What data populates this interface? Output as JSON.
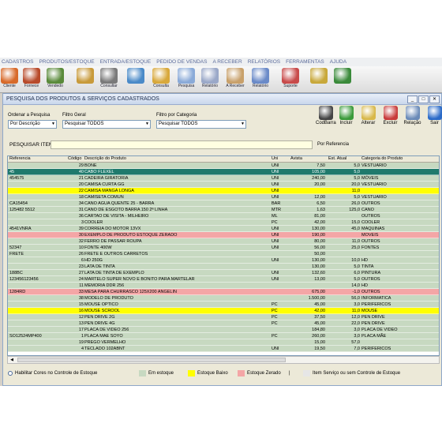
{
  "menu": [
    "CADASTROS",
    "PRODUTOS/ESTOQUE",
    "ENTRADA/ESTOQUE",
    "PEDIDO DE VENDAS",
    "A RECEBER",
    "RELATÓRIOS",
    "FERRAMENTAS",
    "AJUDA"
  ],
  "toolbar": [
    {
      "label": "Cliente",
      "color": "#d86a2a",
      "icon": "client-icon"
    },
    {
      "label": "Fornece",
      "color": "#b84a2a",
      "icon": "supplier-icon"
    },
    {
      "label": "Vendedo",
      "color": "#5a8a3a",
      "icon": "seller-icon"
    },
    {
      "label": "",
      "color": "#c89a3a",
      "icon": "boxes-icon"
    },
    {
      "label": "Consultar",
      "color": "#7a7a7a",
      "icon": "barcode-icon"
    },
    {
      "label": "",
      "color": "#4a8ac8",
      "icon": "monitor-icon"
    },
    {
      "label": "Consulta",
      "color": "#d8a83a",
      "icon": "folder-icon"
    },
    {
      "label": "Pesquisa",
      "color": "#8aaad8",
      "icon": "search-doc-icon"
    },
    {
      "label": "Relatório",
      "color": "#9aa8c8",
      "icon": "report-icon"
    },
    {
      "label": "A Receber",
      "color": "#c8a06a",
      "icon": "receivable-icon"
    },
    {
      "label": "Relatório",
      "color": "#6a8ac8",
      "icon": "report2-icon"
    },
    {
      "label": "Suporte",
      "color": "#c84a4a",
      "icon": "support-icon"
    },
    {
      "label": "",
      "color": "#c8a83a",
      "icon": "coins-icon"
    },
    {
      "label": "",
      "color": "#3a8a3a",
      "icon": "excel-icon"
    }
  ],
  "window": {
    "title": "PESQUISA DOS PRODUTOS & SERVIÇOS CADASTRADOS"
  },
  "filters": {
    "order_label": "Ordenar a Pesquisa",
    "order_value": "Por Descrição",
    "general_label": "Filtro Geral",
    "general_value": "Pesquisar TODOS",
    "category_label": "Filtro por Categoria",
    "category_value": "Pesquisar TODOS"
  },
  "actions": [
    {
      "label": "CodBarra",
      "color": "#444444",
      "icon": "barcode-icon"
    },
    {
      "label": "Incluir",
      "color": "#3a9a3a",
      "icon": "add-icon"
    },
    {
      "label": "Alterar",
      "color": "#d8b84a",
      "icon": "edit-icon"
    },
    {
      "label": "Excluir",
      "color": "#c83a3a",
      "icon": "delete-icon"
    },
    {
      "label": "Relação",
      "color": "#6a8ab8",
      "icon": "list-icon"
    },
    {
      "label": "Sair",
      "color": "#2a6ac8",
      "icon": "exit-icon"
    }
  ],
  "search": {
    "label": "PESQUISAR ITEM",
    "value": "",
    "ref_label": "Por Referencia"
  },
  "columns": [
    "Referencia",
    "Código",
    "Descrição do Produto",
    "Uni",
    "Avista",
    "Est. Atual",
    "Categoria do Produto"
  ],
  "rows": [
    {
      "ref": "",
      "cod": "29",
      "desc": "BONE",
      "uni": "UNI",
      "avista": "7,50",
      "est": "5,0",
      "cat": "VESTUARIO",
      "st": "ok"
    },
    {
      "ref": "45",
      "cod": "40",
      "desc": "CABO FLEXEL",
      "uni": "UNI",
      "avista": "105,00",
      "est": "5,0",
      "cat": "",
      "st": "sel"
    },
    {
      "ref": "454575",
      "cod": "21",
      "desc": "CADEIRA GIRATORIA",
      "uni": "UNI",
      "avista": "240,00",
      "est": "5,0",
      "cat": "MÓVEIS",
      "st": "ok"
    },
    {
      "ref": "",
      "cod": "20",
      "desc": "CAMISA CURTA GG",
      "uni": "UNI",
      "avista": "20,00",
      "est": "20,0",
      "cat": "VESTUARIO",
      "st": "ok"
    },
    {
      "ref": "",
      "cod": "22",
      "desc": "CAMISA MANGA LONGA",
      "uni": "UNI",
      "avista": "",
      "est": "11,0",
      "cat": "",
      "st": "low"
    },
    {
      "ref": "",
      "cod": "18",
      "desc": "CAMISETA COMUN",
      "uni": "UNI",
      "avista": "12,00",
      "est": "5,0",
      "cat": "VESTUARIO",
      "st": "ok"
    },
    {
      "ref": "CA15454",
      "cod": "34",
      "desc": "CANO AGUA QUENTE 25 - BARRA",
      "uni": "BAR",
      "avista": "6,50",
      "est": "26,0",
      "cat": "OUTROS",
      "st": "ok"
    },
    {
      "ref": "125482 5512",
      "cod": "31",
      "desc": "CANO DE ESGOTO BARRA 150 2ª LINHA",
      "uni": "MTR",
      "avista": "1,63",
      "est": "125,0",
      "cat": "CANO",
      "st": "ok"
    },
    {
      "ref": "",
      "cod": "36",
      "desc": "CARTAO DE VISITA - MILHEIRO",
      "uni": "ML",
      "avista": "81,00",
      "est": "",
      "cat": "OUTROS",
      "st": "ok"
    },
    {
      "ref": "",
      "cod": "3",
      "desc": "COOLER",
      "uni": "PC",
      "avista": "42,00",
      "est": "15,0",
      "cat": "COOLER",
      "st": "ok"
    },
    {
      "ref": "4541VNRA",
      "cod": "39",
      "desc": "CORREIA DO MOTOR 13VX",
      "uni": "UNI",
      "avista": "130,00",
      "est": "45,0",
      "cat": "MAQUINAS",
      "st": "ok"
    },
    {
      "ref": "",
      "cod": "30",
      "desc": "EXEMPLO DE PRODUTO ESTOQUE ZERADO",
      "uni": "UNI",
      "avista": "190,00",
      "est": "",
      "cat": "MOVEIS",
      "st": "zero"
    },
    {
      "ref": "",
      "cod": "32",
      "desc": "FERRO DE PASSAR ROUPA",
      "uni": "UNI",
      "avista": "80,00",
      "est": "11,0",
      "cat": "OUTROS",
      "st": "ok"
    },
    {
      "ref": "52347",
      "cod": "10",
      "desc": "FONTE 400W",
      "uni": "UNI",
      "avista": "56,00",
      "est": "25,0",
      "cat": "FONTES",
      "st": "ok"
    },
    {
      "ref": "FRETE",
      "cod": "26",
      "desc": "FRETE E OUTROS CARRETOS",
      "uni": "",
      "avista": "50,00",
      "est": "",
      "cat": "",
      "st": "ok"
    },
    {
      "ref": "",
      "cod": "6",
      "desc": "HD 250G",
      "uni": "UNI",
      "avista": "130,00",
      "est": "10,0",
      "cat": "HD",
      "st": "ok"
    },
    {
      "ref": "",
      "cod": "23",
      "desc": "LATA DE TINTA",
      "uni": "",
      "avista": "130,00",
      "est": "5,0",
      "cat": "TINTA",
      "st": "ok"
    },
    {
      "ref": "188BC",
      "cod": "27",
      "desc": "LATA DE TINTA DE EXEMPLO",
      "uni": "UNI",
      "avista": "132,60",
      "est": "6,0",
      "cat": "PINTURA",
      "st": "ok"
    },
    {
      "ref": "123456123456",
      "cod": "24",
      "desc": "MARTELO SUPER NOVO E BONITO PARA MARTELAR",
      "uni": "UNI",
      "avista": "13,00",
      "est": "5,0",
      "cat": "OUTROS",
      "st": "ok"
    },
    {
      "ref": "",
      "cod": "11",
      "desc": "MEMORIA DDR 256",
      "uni": "",
      "avista": "",
      "est": "14,0",
      "cat": "HD",
      "st": "ok"
    },
    {
      "ref": "1284RD",
      "cod": "33",
      "desc": "MESA PARA CHURRASCO 125X200 ANGELIN",
      "uni": "",
      "avista": "675,00",
      "est": "-1,0",
      "cat": "OUTROS",
      "st": "zero"
    },
    {
      "ref": "",
      "cod": "38",
      "desc": "MODELO DE PRODUTO",
      "uni": "",
      "avista": "1.500,00",
      "est": "56,0",
      "cat": "INFORMATICA",
      "st": "ok"
    },
    {
      "ref": "",
      "cod": "15",
      "desc": "MOUSE OPTICO",
      "uni": "PC",
      "avista": "45,00",
      "est": "3,0",
      "cat": "PERIFERICOS",
      "st": "ok"
    },
    {
      "ref": "",
      "cod": "16",
      "desc": "MOUSE SCROOL",
      "uni": "PC",
      "avista": "42,00",
      "est": "11,0",
      "cat": "MOUSE",
      "st": "low"
    },
    {
      "ref": "",
      "cod": "12",
      "desc": "PEN DRIVE 2G",
      "uni": "PC",
      "avista": "37,50",
      "est": "12,0",
      "cat": "PEN DRIVE",
      "st": "ok"
    },
    {
      "ref": "",
      "cod": "13",
      "desc": "PEN DRIVE 4G",
      "uni": "PC",
      "avista": "45,00",
      "est": "22,0",
      "cat": "PEN DRIVE",
      "st": "ok"
    },
    {
      "ref": "",
      "cod": "17",
      "desc": "PLACA DE VIDEO 256",
      "uni": "",
      "avista": "184,80",
      "est": "3,0",
      "cat": "PLACA DE VIDEO",
      "st": "ok"
    },
    {
      "ref": "SO12524MP400",
      "cod": "1",
      "desc": "PLACA MAE SOYO",
      "uni": "PC",
      "avista": "260,00",
      "est": "3,0",
      "cat": "PLACA MÃE",
      "st": "ok"
    },
    {
      "ref": "",
      "cod": "19",
      "desc": "PREGO VERMELHO",
      "uni": "",
      "avista": "15,00",
      "est": "57,0",
      "cat": "",
      "st": "ok"
    },
    {
      "ref": "",
      "cod": "4",
      "desc": "TECLADO 102ABNT",
      "uni": "UNI",
      "avista": "19,50",
      "est": "7,0",
      "cat": "PERIFERICOS",
      "st": "ok"
    }
  ],
  "legend": {
    "toggle": "Habilitar Cores no Controle de Estoque",
    "ok": "Em estoque",
    "low": "Estoque Baixo",
    "zero": "Estoque Zerado",
    "sep": "|",
    "service": "Item Serviço ou sem Controle de Estoque"
  },
  "colors": {
    "ok": "#c7d9c1",
    "low": "#ffff00",
    "zero": "#f4a6a6",
    "sel": "#1f7a6c",
    "service": "#e6e6e6"
  }
}
